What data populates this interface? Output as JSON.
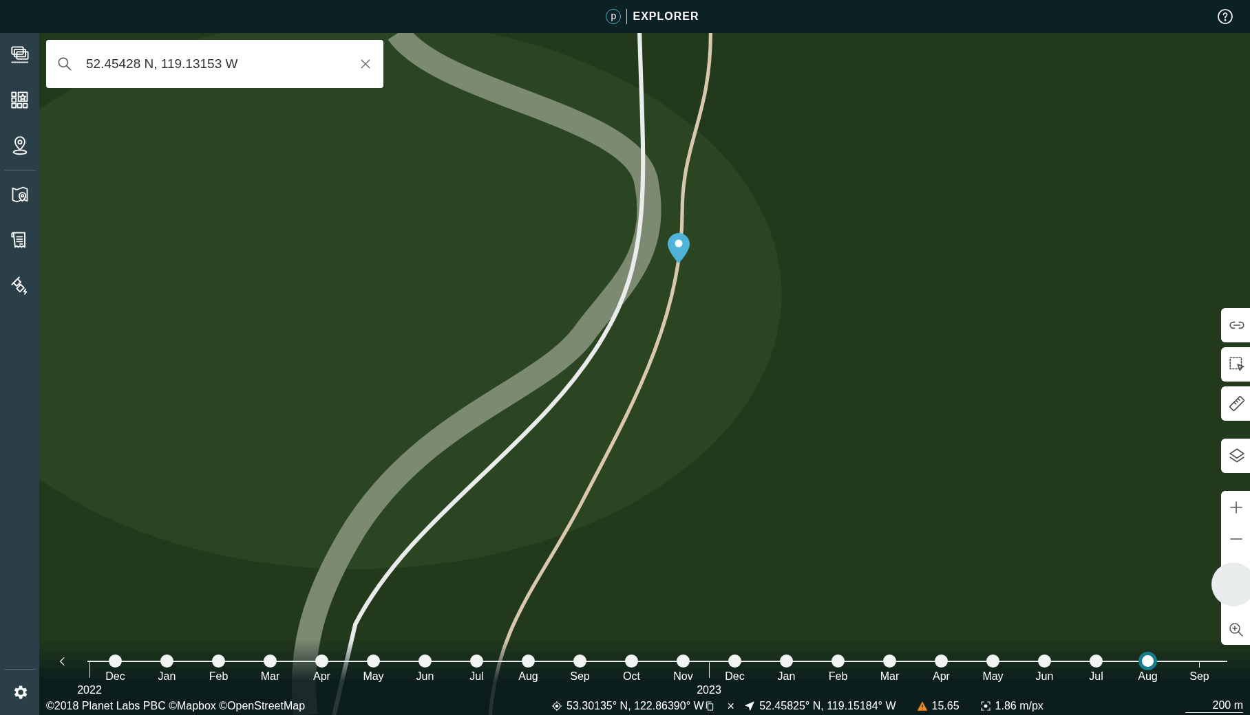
{
  "header": {
    "logo": "p",
    "title": "EXPLORER"
  },
  "search": {
    "value": "52.45428 N, 119.13153 W"
  },
  "timeline": {
    "months": [
      {
        "label": "Dec",
        "kind": "dot",
        "selected": false,
        "year": "2022"
      },
      {
        "label": "Jan",
        "kind": "dot",
        "selected": false
      },
      {
        "label": "Feb",
        "kind": "dot",
        "selected": false
      },
      {
        "label": "Mar",
        "kind": "dot",
        "selected": false
      },
      {
        "label": "Apr",
        "kind": "dot",
        "selected": false
      },
      {
        "label": "May",
        "kind": "dot",
        "selected": false
      },
      {
        "label": "Jun",
        "kind": "dot",
        "selected": false
      },
      {
        "label": "Jul",
        "kind": "dot",
        "selected": false
      },
      {
        "label": "Aug",
        "kind": "dot",
        "selected": false
      },
      {
        "label": "Sep",
        "kind": "dot",
        "selected": false
      },
      {
        "label": "Oct",
        "kind": "dot",
        "selected": false
      },
      {
        "label": "Nov",
        "kind": "dot",
        "selected": false
      },
      {
        "label": "Dec",
        "kind": "dot",
        "selected": false,
        "year": "2023"
      },
      {
        "label": "Jan",
        "kind": "dot",
        "selected": false
      },
      {
        "label": "Feb",
        "kind": "dot",
        "selected": false
      },
      {
        "label": "Mar",
        "kind": "dot",
        "selected": false
      },
      {
        "label": "Apr",
        "kind": "dot",
        "selected": false
      },
      {
        "label": "May",
        "kind": "dot",
        "selected": false
      },
      {
        "label": "Jun",
        "kind": "dot",
        "selected": false
      },
      {
        "label": "Jul",
        "kind": "dot",
        "selected": false
      },
      {
        "label": "Aug",
        "kind": "dot",
        "selected": true
      },
      {
        "label": "Sep",
        "kind": "tick",
        "selected": false
      }
    ]
  },
  "status_bar": {
    "attribution": "©2018 Planet Labs PBC ©Mapbox ©OpenStreetMap",
    "cursor_coordinates": "53.30135° N, 122.86390° W",
    "dismiss": "×",
    "location_coordinates": "52.45825° N, 119.15184° W",
    "warning_value": "15.65",
    "resolution": "1.86 m/px",
    "scale": "200 m"
  }
}
